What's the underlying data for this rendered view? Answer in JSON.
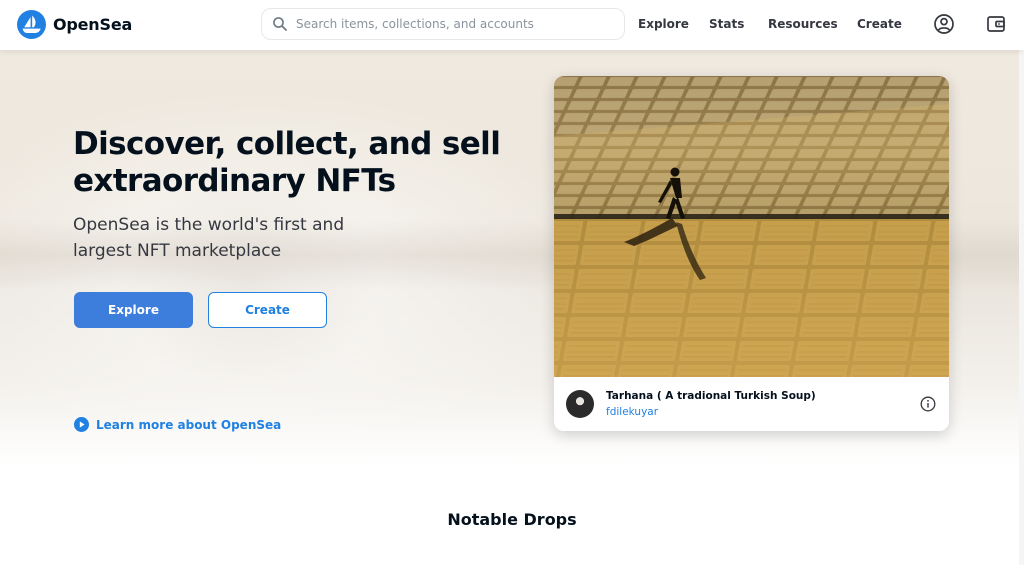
{
  "header": {
    "brand": "OpenSea",
    "search_placeholder": "Search items, collections, and accounts",
    "nav": [
      "Explore",
      "Stats",
      "Resources",
      "Create"
    ],
    "accent_color": "#2081e2",
    "icons": [
      "opensea-logo-icon",
      "search-icon",
      "account-icon",
      "wallet-icon"
    ]
  },
  "hero": {
    "title_lines": [
      "Discover, collect, and sell",
      "extraordinary NFTs"
    ],
    "subtitle_lines": [
      "OpenSea is the world's first and",
      "largest NFT marketplace"
    ],
    "explore_label": "Explore",
    "create_label": "Create",
    "learn_more": "Learn more about OpenSea",
    "primary_button_color": "#3d7ddc"
  },
  "featured": {
    "title": "Tarhana ( A tradional Turkish Soup)",
    "creator": "fdilekuyar",
    "icon": "info-icon"
  },
  "section": {
    "title": "Notable Drops"
  }
}
